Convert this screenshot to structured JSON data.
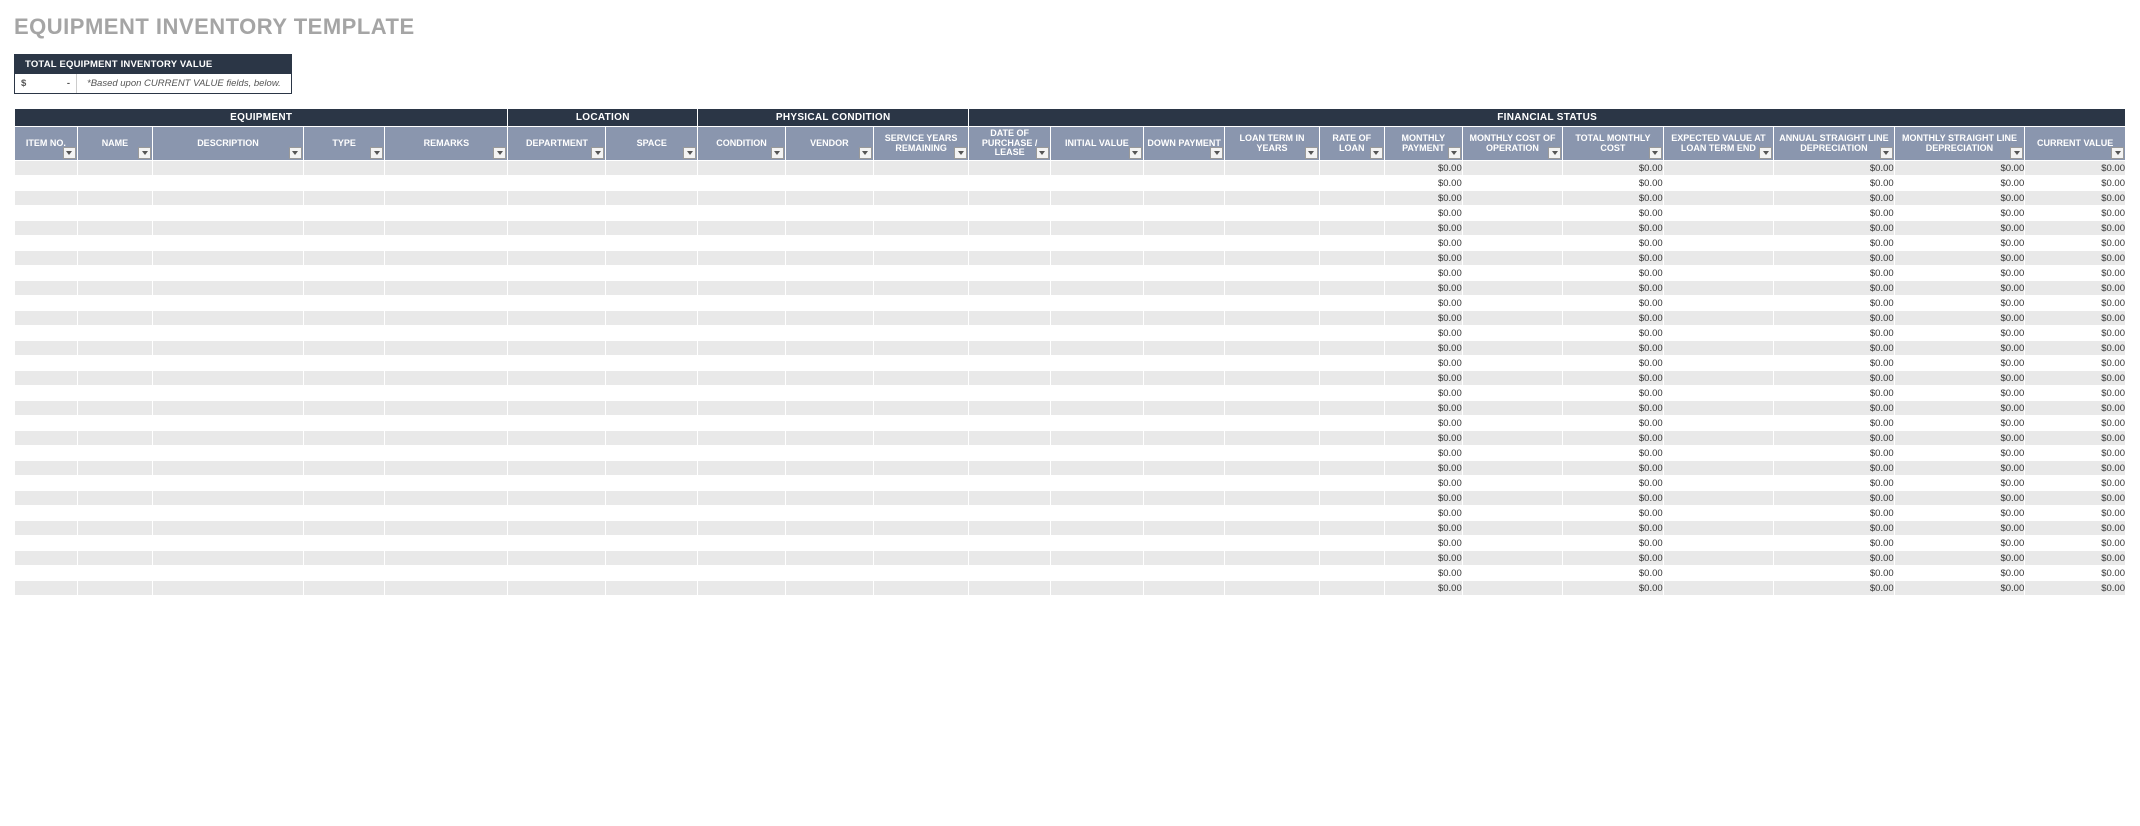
{
  "title": "EQUIPMENT INVENTORY TEMPLATE",
  "summary": {
    "header": "TOTAL EQUIPMENT INVENTORY VALUE",
    "currency": "$",
    "value": "-",
    "note": "*Based upon CURRENT VALUE fields, below."
  },
  "groups": [
    {
      "label": "EQUIPMENT",
      "span": 5
    },
    {
      "label": "LOCATION",
      "span": 2
    },
    {
      "label": "PHYSICAL CONDITION",
      "span": 3
    },
    {
      "label": "FINANCIAL STATUS",
      "span": 12
    }
  ],
  "columns": [
    "ITEM NO.",
    "NAME",
    "DESCRIPTION",
    "TYPE",
    "REMARKS",
    "DEPARTMENT",
    "SPACE",
    "CONDITION",
    "VENDOR",
    "SERVICE YEARS REMAINING",
    "DATE OF PURCHASE / LEASE",
    "INITIAL VALUE",
    "DOWN PAYMENT",
    "LOAN TERM IN YEARS",
    "RATE OF LOAN",
    "MONTHLY PAYMENT",
    "MONTHLY COST OF OPERATION",
    "TOTAL MONTHLY COST",
    "EXPECTED VALUE AT LOAN TERM END",
    "ANNUAL STRAIGHT LINE DEPRECIATION",
    "MONTHLY STRAIGHT LINE DEPRECIATION",
    "CURRENT VALUE"
  ],
  "value_columns": [
    15,
    17,
    19,
    20,
    21
  ],
  "row_count": 29,
  "cell_value": "$0.00"
}
